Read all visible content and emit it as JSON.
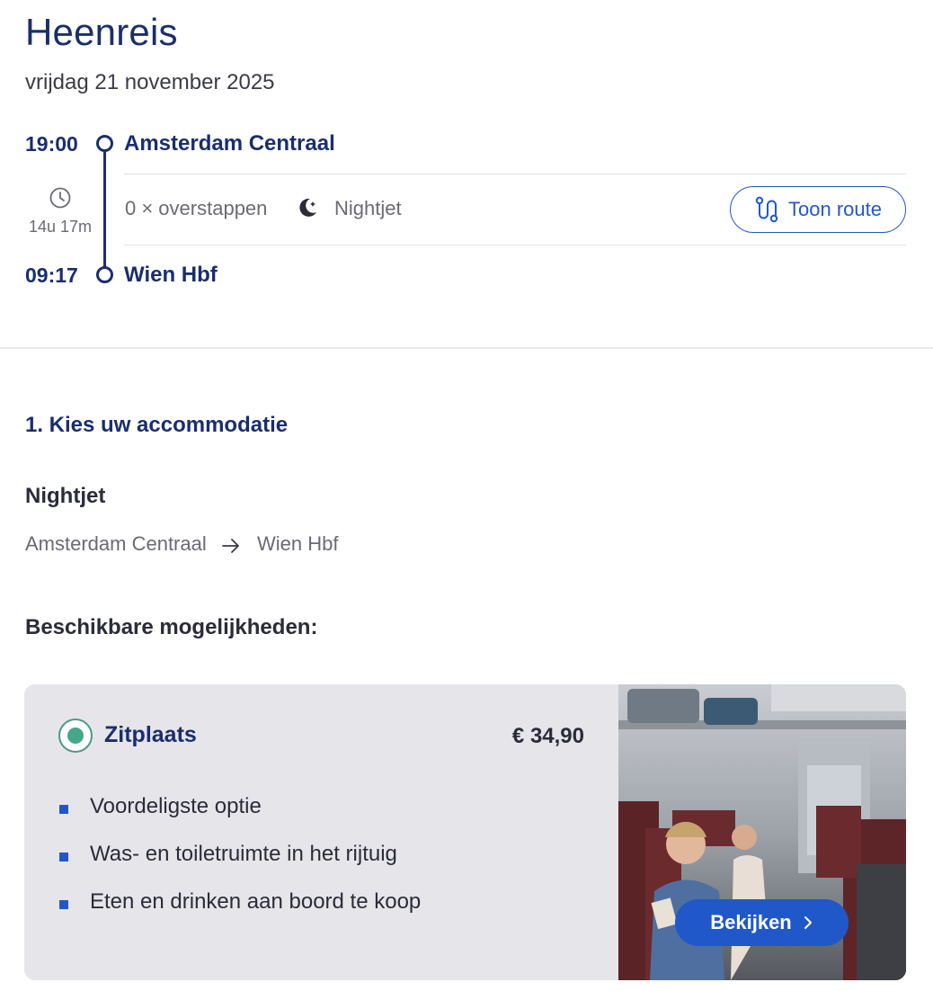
{
  "header": {
    "title": "Heenreis",
    "date": "vrijdag 21 november 2025"
  },
  "journey": {
    "departure": {
      "time": "19:00",
      "station": "Amsterdam Centraal"
    },
    "arrival": {
      "time": "09:17",
      "station": "Wien Hbf"
    },
    "duration": "14u 17m",
    "transfers": "0 × overstappen",
    "train_type": "Nightjet",
    "route_button": "Toon route"
  },
  "accommodation": {
    "step_title": "1. Kies uw accommodatie",
    "product": "Nightjet",
    "from": "Amsterdam Centraal",
    "to": "Wien Hbf",
    "available_title": "Beschikbare mogelijkheden:"
  },
  "option": {
    "name": "Zitplaats",
    "price": "€ 34,90",
    "selected": true,
    "features": [
      "Voordeligste optie",
      "Was- en toiletruimte in het rijtuig",
      "Eten en drinken aan boord te koop"
    ],
    "view_button": "Bekijken"
  },
  "colors": {
    "brand_navy": "#1a2e6e",
    "accent_blue": "#2158c9",
    "selected_green": "#48a688",
    "card_bg": "#e6e6ea"
  }
}
